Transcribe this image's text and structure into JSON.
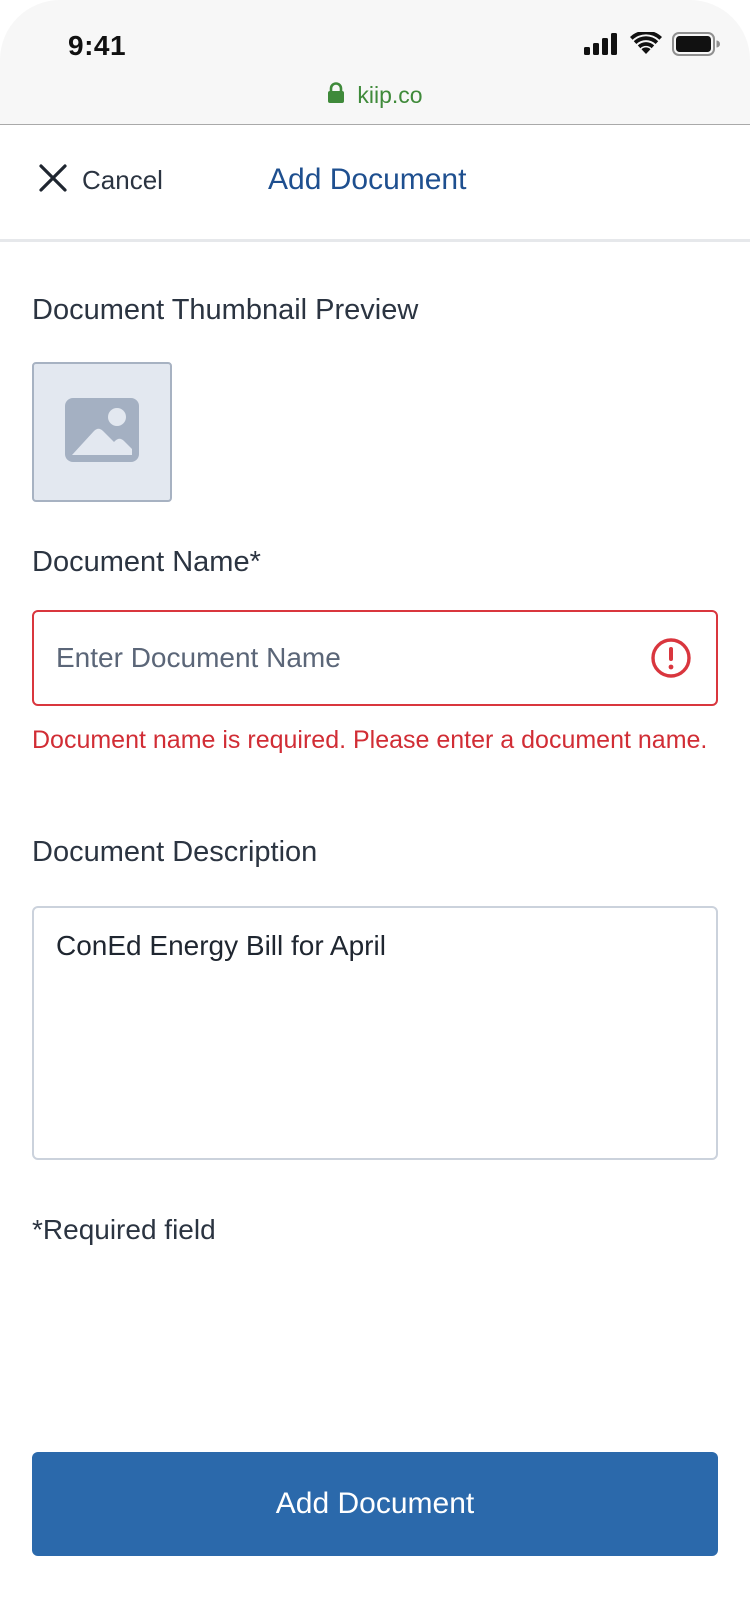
{
  "status_bar": {
    "time": "9:41",
    "icons": [
      "cellular-signal-icon",
      "wifi-icon",
      "battery-icon"
    ]
  },
  "browser": {
    "url": "kiip.co",
    "secure_icon": "lock-icon",
    "url_color": "#3f8a3a"
  },
  "header": {
    "cancel_label": "Cancel",
    "cancel_icon": "close-icon",
    "title": "Add Document",
    "title_color": "#1e4f8f"
  },
  "form": {
    "thumbnail": {
      "label": "Document Thumbnail Preview",
      "icon": "image-placeholder-icon"
    },
    "name": {
      "label": "Document Name*",
      "placeholder": "Enter Document Name",
      "value": "",
      "error_icon": "alert-circle-icon",
      "error": "Document name is required. Please enter a document name.",
      "error_color": "#d12d35"
    },
    "description": {
      "label": "Document Description",
      "value": "ConEd Energy Bill for April"
    },
    "required_note": "*Required field",
    "submit_label": "Add Document",
    "submit_color": "#2b69ab"
  }
}
